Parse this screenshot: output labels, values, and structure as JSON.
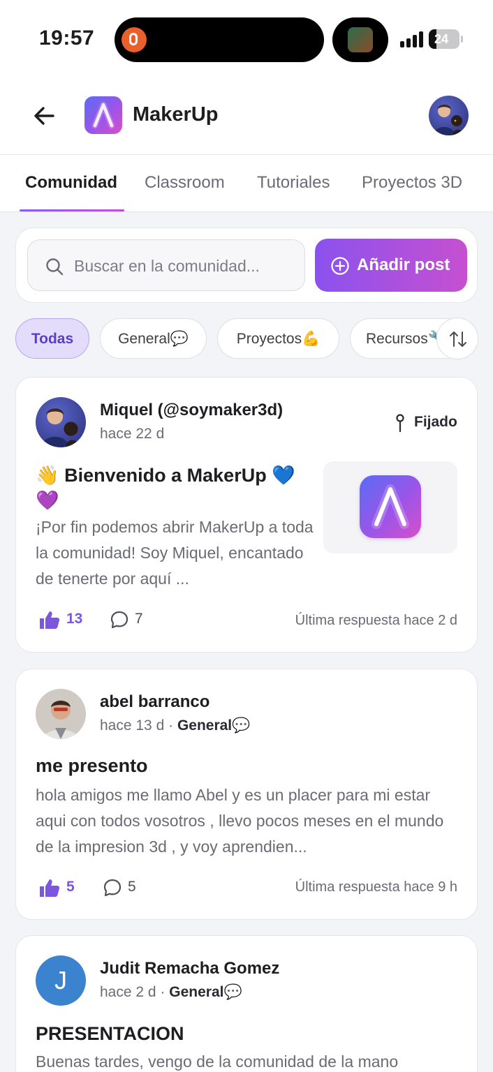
{
  "status_bar": {
    "time": "19:57",
    "battery": "24"
  },
  "header": {
    "app_name": "MakerUp"
  },
  "tabs": [
    {
      "label": "Comunidad",
      "active": true
    },
    {
      "label": "Classroom",
      "active": false
    },
    {
      "label": "Tutoriales",
      "active": false
    },
    {
      "label": "Proyectos 3D",
      "active": false
    }
  ],
  "search": {
    "placeholder": "Buscar en la comunidad..."
  },
  "add_post": {
    "label": "Añadir post"
  },
  "filters": [
    {
      "label": "Todas",
      "active": true
    },
    {
      "label": "General💬",
      "active": false
    },
    {
      "label": "Proyectos💪",
      "active": false
    },
    {
      "label": "Recursos🔧",
      "active": false
    }
  ],
  "posts": [
    {
      "author": "Miquel (@soymaker3d)",
      "time": "hace 22 d",
      "category": "",
      "pinned_label": "Fijado",
      "title": "👋 Bienvenido a MakerUp 💙💜",
      "body": "¡Por fin podemos abrir MakerUp a toda la comunidad! Soy Miquel, encantado de tenerte por aquí ...",
      "likes": "13",
      "comments": "7",
      "last_reply": "Última respuesta hace 2 d"
    },
    {
      "author": "abel barranco",
      "time": "hace 13 d",
      "separator": "·",
      "category": "General💬",
      "title": "me presento",
      "body": "hola amigos me llamo Abel y es un placer para mi estar aqui con todos vosotros , llevo pocos meses en el mundo de la impresion 3d , y voy aprendien...",
      "likes": "5",
      "comments": "5",
      "last_reply": "Última respuesta hace 9 h"
    },
    {
      "author": "Judit Remacha Gomez",
      "initial": "J",
      "time": "hace 2 d",
      "separator": "·",
      "category": "General💬",
      "title": "PRESENTACION",
      "body": "Buenas tardes, vengo de la comunidad de la mano"
    }
  ]
}
